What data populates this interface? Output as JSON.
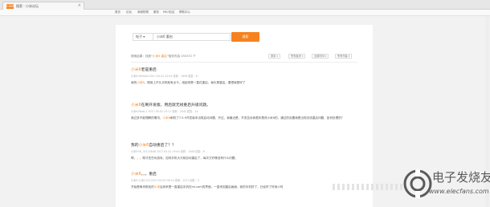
{
  "browser": {
    "tab_logo": "CSDN",
    "tab_title": "搜索 - 小米论坛",
    "tab_close": "×",
    "nav_items": [
      "首页",
      "论坛",
      "商城购物",
      "服务",
      "MIUI社区",
      "帮助中心"
    ]
  },
  "search": {
    "scope_label": "帖子 ▾",
    "query": "小米6 重启",
    "button_label": "搜索"
  },
  "stats": {
    "prefix": "搜索结果：找到“",
    "keyword": "小米6 重启",
    "suffix": "”相关内容 191572 个"
  },
  "filters": [
    "排序 ▾",
    "所有板块 ▾",
    "全部时间 ▾",
    "所有作者 ▾"
  ],
  "results": [
    {
      "title_pre": "",
      "title_hl": "小米6",
      "title_post": "老是重启",
      "meta": "小米6  Miklead   2017-05-02 10:04   查看：1656   回复：8",
      "snippet_pre": "我的",
      "snippet_hl": "小米6",
      "snippet_post": "，刚用上不久手机就有点卡，用起来是一直在重启，每头是重启，要很就是好了"
    },
    {
      "title_pre": "",
      "title_hl": "小米6",
      "title_post": "在刷开发版，用后就无线重启升级问题。",
      "meta": "小米6  Rado.1   2017-05-02 23:11   查看：2042   回复：14",
      "snippet_pre": "我过多不能理解的情况，",
      "snippet_hl": "小米6",
      "snippet_post": "刷机了7.5.9开发版本出现启动问题，开过，我最近是，开发告诉我根本是改小米6的，通过的设置我是出现无线重启问题，如何处理的？"
    },
    {
      "title_pre": "我的",
      "title_hl": "小米6",
      "title_post": "自动重启了？？",
      "meta": "小米6  Mi_32115846   2017-05-02 19:44   查看：1508   回复：6",
      "snippet_pre": "啊，，，刚才还在玩游戏，",
      "snippet_hl": "",
      "snippet_post": "如何手机大头就自动重启了，每次又好像没有什么问题。"
    },
    {
      "title_pre": "",
      "title_hl": "小米6",
      "title_post": "，，，重启",
      "meta": "小米6  小米1234   2017-05-03 09:14   查看：1217   回复：5",
      "snippet_pre": "开始是两块那加的",
      "snippet_hl": "小米",
      "snippet_post": "后然来是一直重启手机在mi.com的界面，一直来回重启画面，我的手机好了，已经好了好用小时"
    }
  ],
  "watermark": {
    "text": "电子发烧友",
    "url": "www.elecfans.com"
  },
  "colors": {
    "accent": "#f5821f"
  }
}
